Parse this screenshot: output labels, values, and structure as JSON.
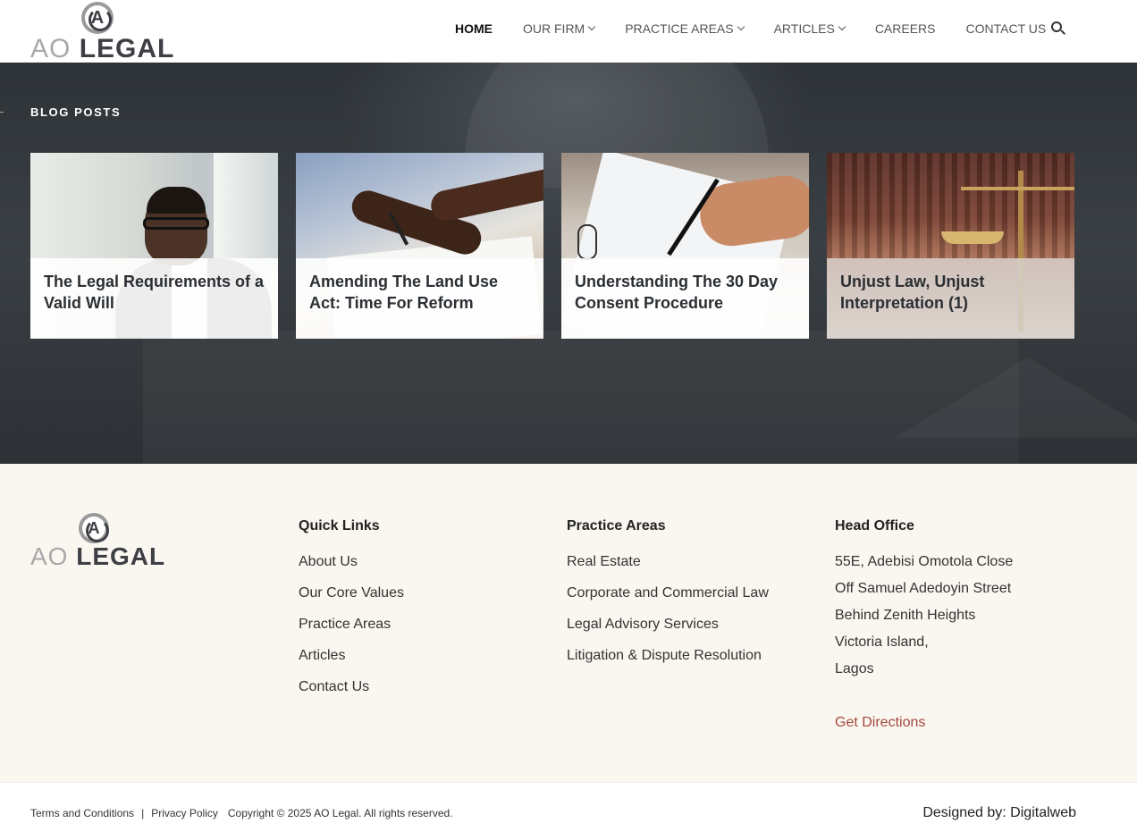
{
  "brand": {
    "logo_ao": "AO",
    "logo_legal": "LEGAL",
    "logo_mark": "A"
  },
  "nav": {
    "items": [
      {
        "label": "HOME",
        "active": true,
        "dropdown": false
      },
      {
        "label": "OUR FIRM",
        "active": false,
        "dropdown": true
      },
      {
        "label": "PRACTICE AREAS",
        "active": false,
        "dropdown": true
      },
      {
        "label": "ARTICLES",
        "active": false,
        "dropdown": true
      },
      {
        "label": "CAREERS",
        "active": false,
        "dropdown": false
      },
      {
        "label": "CONTACT US",
        "active": false,
        "dropdown": false
      }
    ],
    "search_icon": "search-icon"
  },
  "blog": {
    "heading": "BLOG POSTS",
    "posts": [
      {
        "title": "The Legal Requirements of a Valid Will"
      },
      {
        "title": "Amending The Land Use Act: Time For Reform"
      },
      {
        "title": "Understanding The 30 Day Consent Procedure"
      },
      {
        "title": "Unjust Law, Unjust Interpretation (1)"
      }
    ]
  },
  "footer": {
    "quick_links": {
      "heading": "Quick Links",
      "items": [
        "About Us",
        "Our Core Values",
        "Practice Areas",
        "Articles",
        "Contact Us"
      ]
    },
    "practice_areas": {
      "heading": "Practice Areas",
      "items": [
        "Real Estate",
        "Corporate and Commercial Law",
        "Legal Advisory Services",
        "Litigation & Dispute Resolution"
      ]
    },
    "head_office": {
      "heading": "Head Office",
      "lines": [
        "55E, Adebisi Omotola Close",
        "Off Samuel Adedoyin Street",
        "Behind Zenith Heights",
        "Victoria Island,",
        "Lagos"
      ],
      "directions": "Get Directions"
    }
  },
  "bottom_bar": {
    "terms": "Terms and Conditions",
    "separator": "|",
    "privacy": "Privacy Policy",
    "copyright": "Copyright © 2025 AO Legal. All rights reserved.",
    "designed_by": "Designed by: Digitalweb"
  },
  "colors": {
    "accent_link": "#a4483f",
    "footer_bg": "#faf7f0",
    "blog_bg": "#33383c"
  }
}
